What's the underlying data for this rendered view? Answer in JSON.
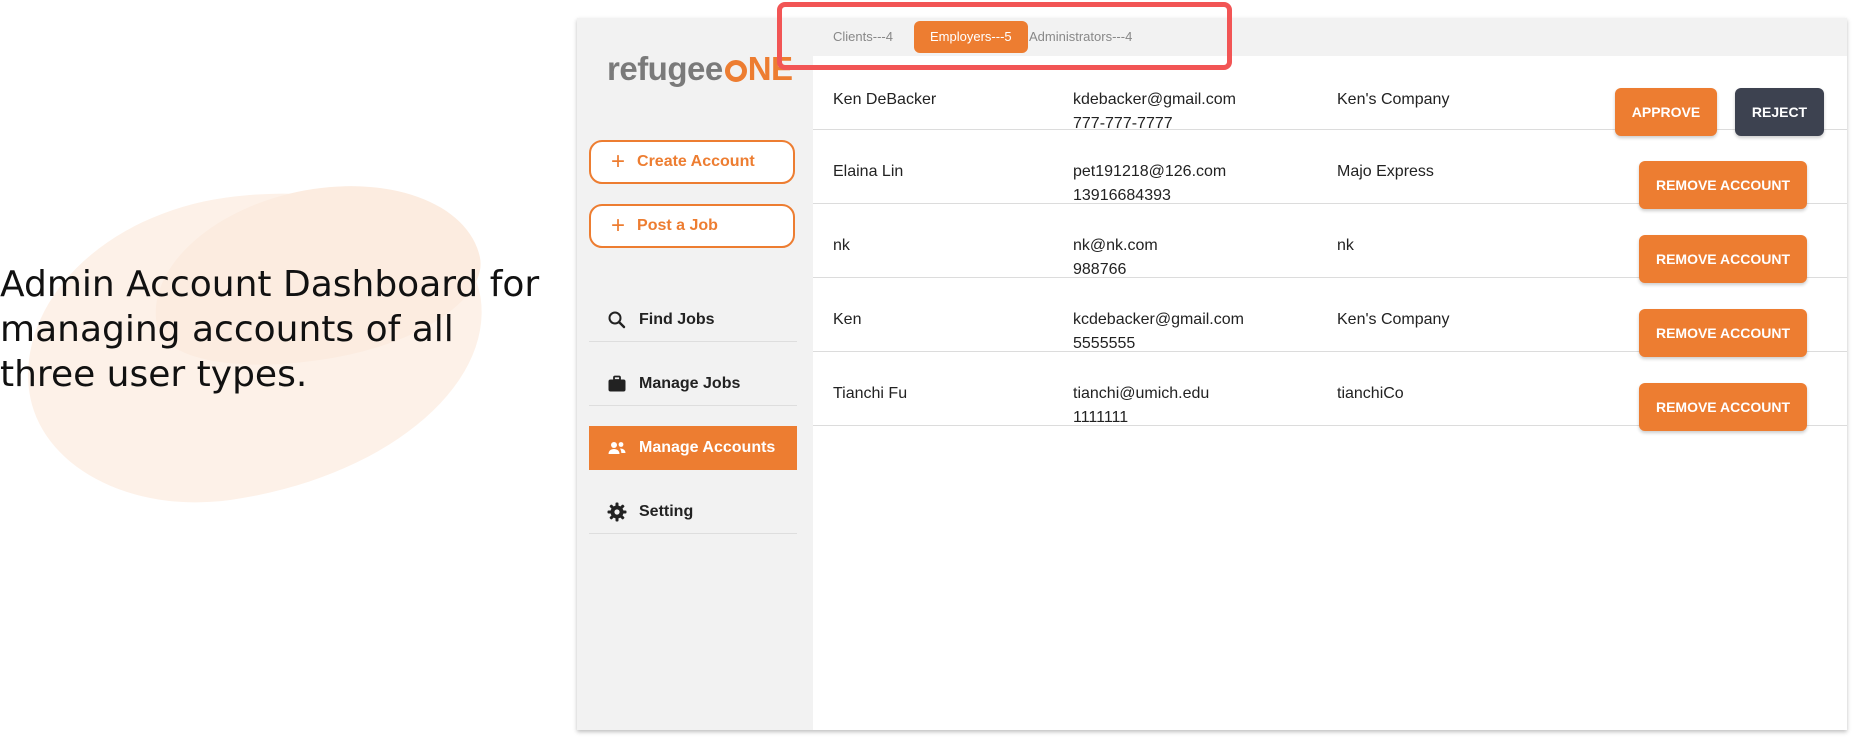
{
  "caption": "Admin Account Dashboard for managing accounts of all three user types.",
  "logo": {
    "text_part": "refugee",
    "accent_part": "NE"
  },
  "sidebar": {
    "actions": [
      {
        "label": "Create Account",
        "icon": "plus-icon"
      },
      {
        "label": "Post a Job",
        "icon": "plus-icon"
      }
    ],
    "nav": [
      {
        "label": "Find Jobs",
        "icon": "search-icon",
        "active": false
      },
      {
        "label": "Manage Jobs",
        "icon": "briefcase-icon",
        "active": false
      },
      {
        "label": "Manage Accounts",
        "icon": "users-icon",
        "active": true
      },
      {
        "label": "Setting",
        "icon": "gear-icon",
        "active": false
      }
    ]
  },
  "tabs": [
    {
      "label": "Clients---4",
      "active": false
    },
    {
      "label": "Employers---5",
      "active": true
    },
    {
      "label": "Administrators---4",
      "active": false
    }
  ],
  "accounts": [
    {
      "name": "Ken DeBacker",
      "email": "kdebacker@gmail.com",
      "phone": "777-777-7777",
      "company": "Ken's Company",
      "actions": [
        "APPROVE",
        "REJECT"
      ]
    },
    {
      "name": "Elaina Lin",
      "email": "pet191218@126.com",
      "phone": "13916684393",
      "company": "Majo Express",
      "actions": [
        "REMOVE ACCOUNT"
      ]
    },
    {
      "name": "nk",
      "email": "nk@nk.com",
      "phone": "988766",
      "company": "nk",
      "actions": [
        "REMOVE ACCOUNT"
      ]
    },
    {
      "name": "Ken",
      "email": "kcdebacker@gmail.com",
      "phone": "5555555",
      "company": "Ken's Company",
      "actions": [
        "REMOVE ACCOUNT"
      ]
    },
    {
      "name": "Tianchi Fu",
      "email": "tianchi@umich.edu",
      "phone": "1111111",
      "company": "tianchiCo",
      "actions": [
        "REMOVE ACCOUNT"
      ]
    }
  ],
  "colors": {
    "accent": "#ed7d31",
    "dark_button": "#3d4250",
    "highlight": "#f25555",
    "sidebar_bg": "#f2f2f2"
  }
}
